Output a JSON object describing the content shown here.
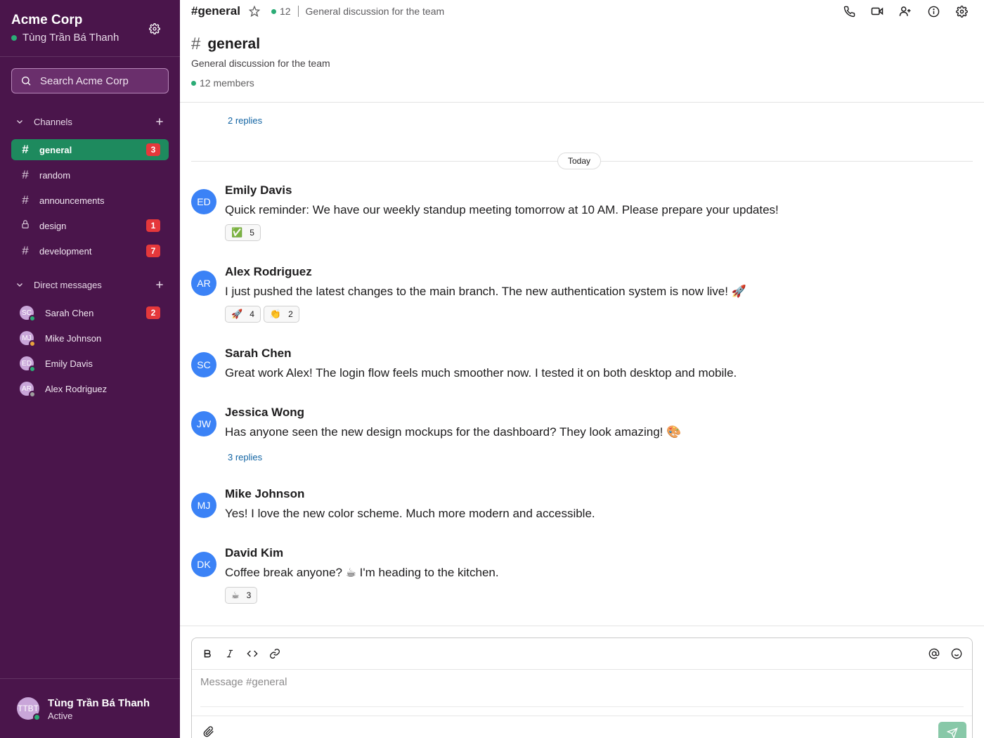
{
  "workspace": {
    "name": "Acme Corp",
    "user": "Tùng Trần Bá Thanh"
  },
  "search": {
    "placeholder": "Search Acme Corp"
  },
  "channels_section": {
    "label": "Channels"
  },
  "channels": [
    {
      "name": "general",
      "badge": "3",
      "icon": "hash"
    },
    {
      "name": "random",
      "badge": "",
      "icon": "hash"
    },
    {
      "name": "announcements",
      "badge": "",
      "icon": "hash"
    },
    {
      "name": "design",
      "badge": "1",
      "icon": "lock"
    },
    {
      "name": "development",
      "badge": "7",
      "icon": "hash"
    }
  ],
  "dm_section": {
    "label": "Direct messages"
  },
  "dms": [
    {
      "name": "Sarah Chen",
      "initials": "SC",
      "status": "online",
      "badge": "2"
    },
    {
      "name": "Mike Johnson",
      "initials": "MJ",
      "status": "away",
      "badge": ""
    },
    {
      "name": "Emily Davis",
      "initials": "ED",
      "status": "online",
      "badge": ""
    },
    {
      "name": "Alex Rodriguez",
      "initials": "AR",
      "status": "offline",
      "badge": ""
    }
  ],
  "footer_user": {
    "name": "Tùng Trần Bá Thanh",
    "initials": "TTBT",
    "status": "Active"
  },
  "topbar": {
    "channel": "#general",
    "member_count": "12",
    "topic": "General discussion for the team"
  },
  "channel_header": {
    "hash": "#",
    "name": "general",
    "description": "General discussion for the team",
    "members": "12 members"
  },
  "earlier_replies": "2 replies",
  "day_divider": "Today",
  "messages": [
    {
      "initials": "ED",
      "author": "Emily Davis",
      "text": "Quick reminder: We have our weekly standup meeting tomorrow at 10 AM. Please prepare your updates!",
      "reactions": [
        {
          "emoji": "✅",
          "count": "5"
        }
      ],
      "replies": ""
    },
    {
      "initials": "AR",
      "author": "Alex Rodriguez",
      "text": "I just pushed the latest changes to the main branch. The new authentication system is now live! 🚀",
      "reactions": [
        {
          "emoji": "🚀",
          "count": "4"
        },
        {
          "emoji": "👏",
          "count": "2"
        }
      ],
      "replies": ""
    },
    {
      "initials": "SC",
      "author": "Sarah Chen",
      "text": "Great work Alex! The login flow feels much smoother now. I tested it on both desktop and mobile.",
      "reactions": [],
      "replies": ""
    },
    {
      "initials": "JW",
      "author": "Jessica Wong",
      "text": "Has anyone seen the new design mockups for the dashboard? They look amazing! 🎨",
      "reactions": [],
      "replies": "3 replies"
    },
    {
      "initials": "MJ",
      "author": "Mike Johnson",
      "text": "Yes! I love the new color scheme. Much more modern and accessible.",
      "reactions": [],
      "replies": ""
    },
    {
      "initials": "DK",
      "author": "David Kim",
      "text": "Coffee break anyone? ☕ I'm heading to the kitchen.",
      "reactions": [
        {
          "emoji": "☕",
          "count": "3"
        }
      ],
      "replies": ""
    }
  ],
  "composer": {
    "placeholder": "Message #general"
  },
  "colors": {
    "sidebar": "#4a154b",
    "active_channel": "#1e8a5e",
    "badge": "#e5383b",
    "avatar": "#3b82f6",
    "online": "#2bac76",
    "away": "#e8a33d",
    "offline": "#9e9e9e",
    "link": "#1264a3"
  }
}
